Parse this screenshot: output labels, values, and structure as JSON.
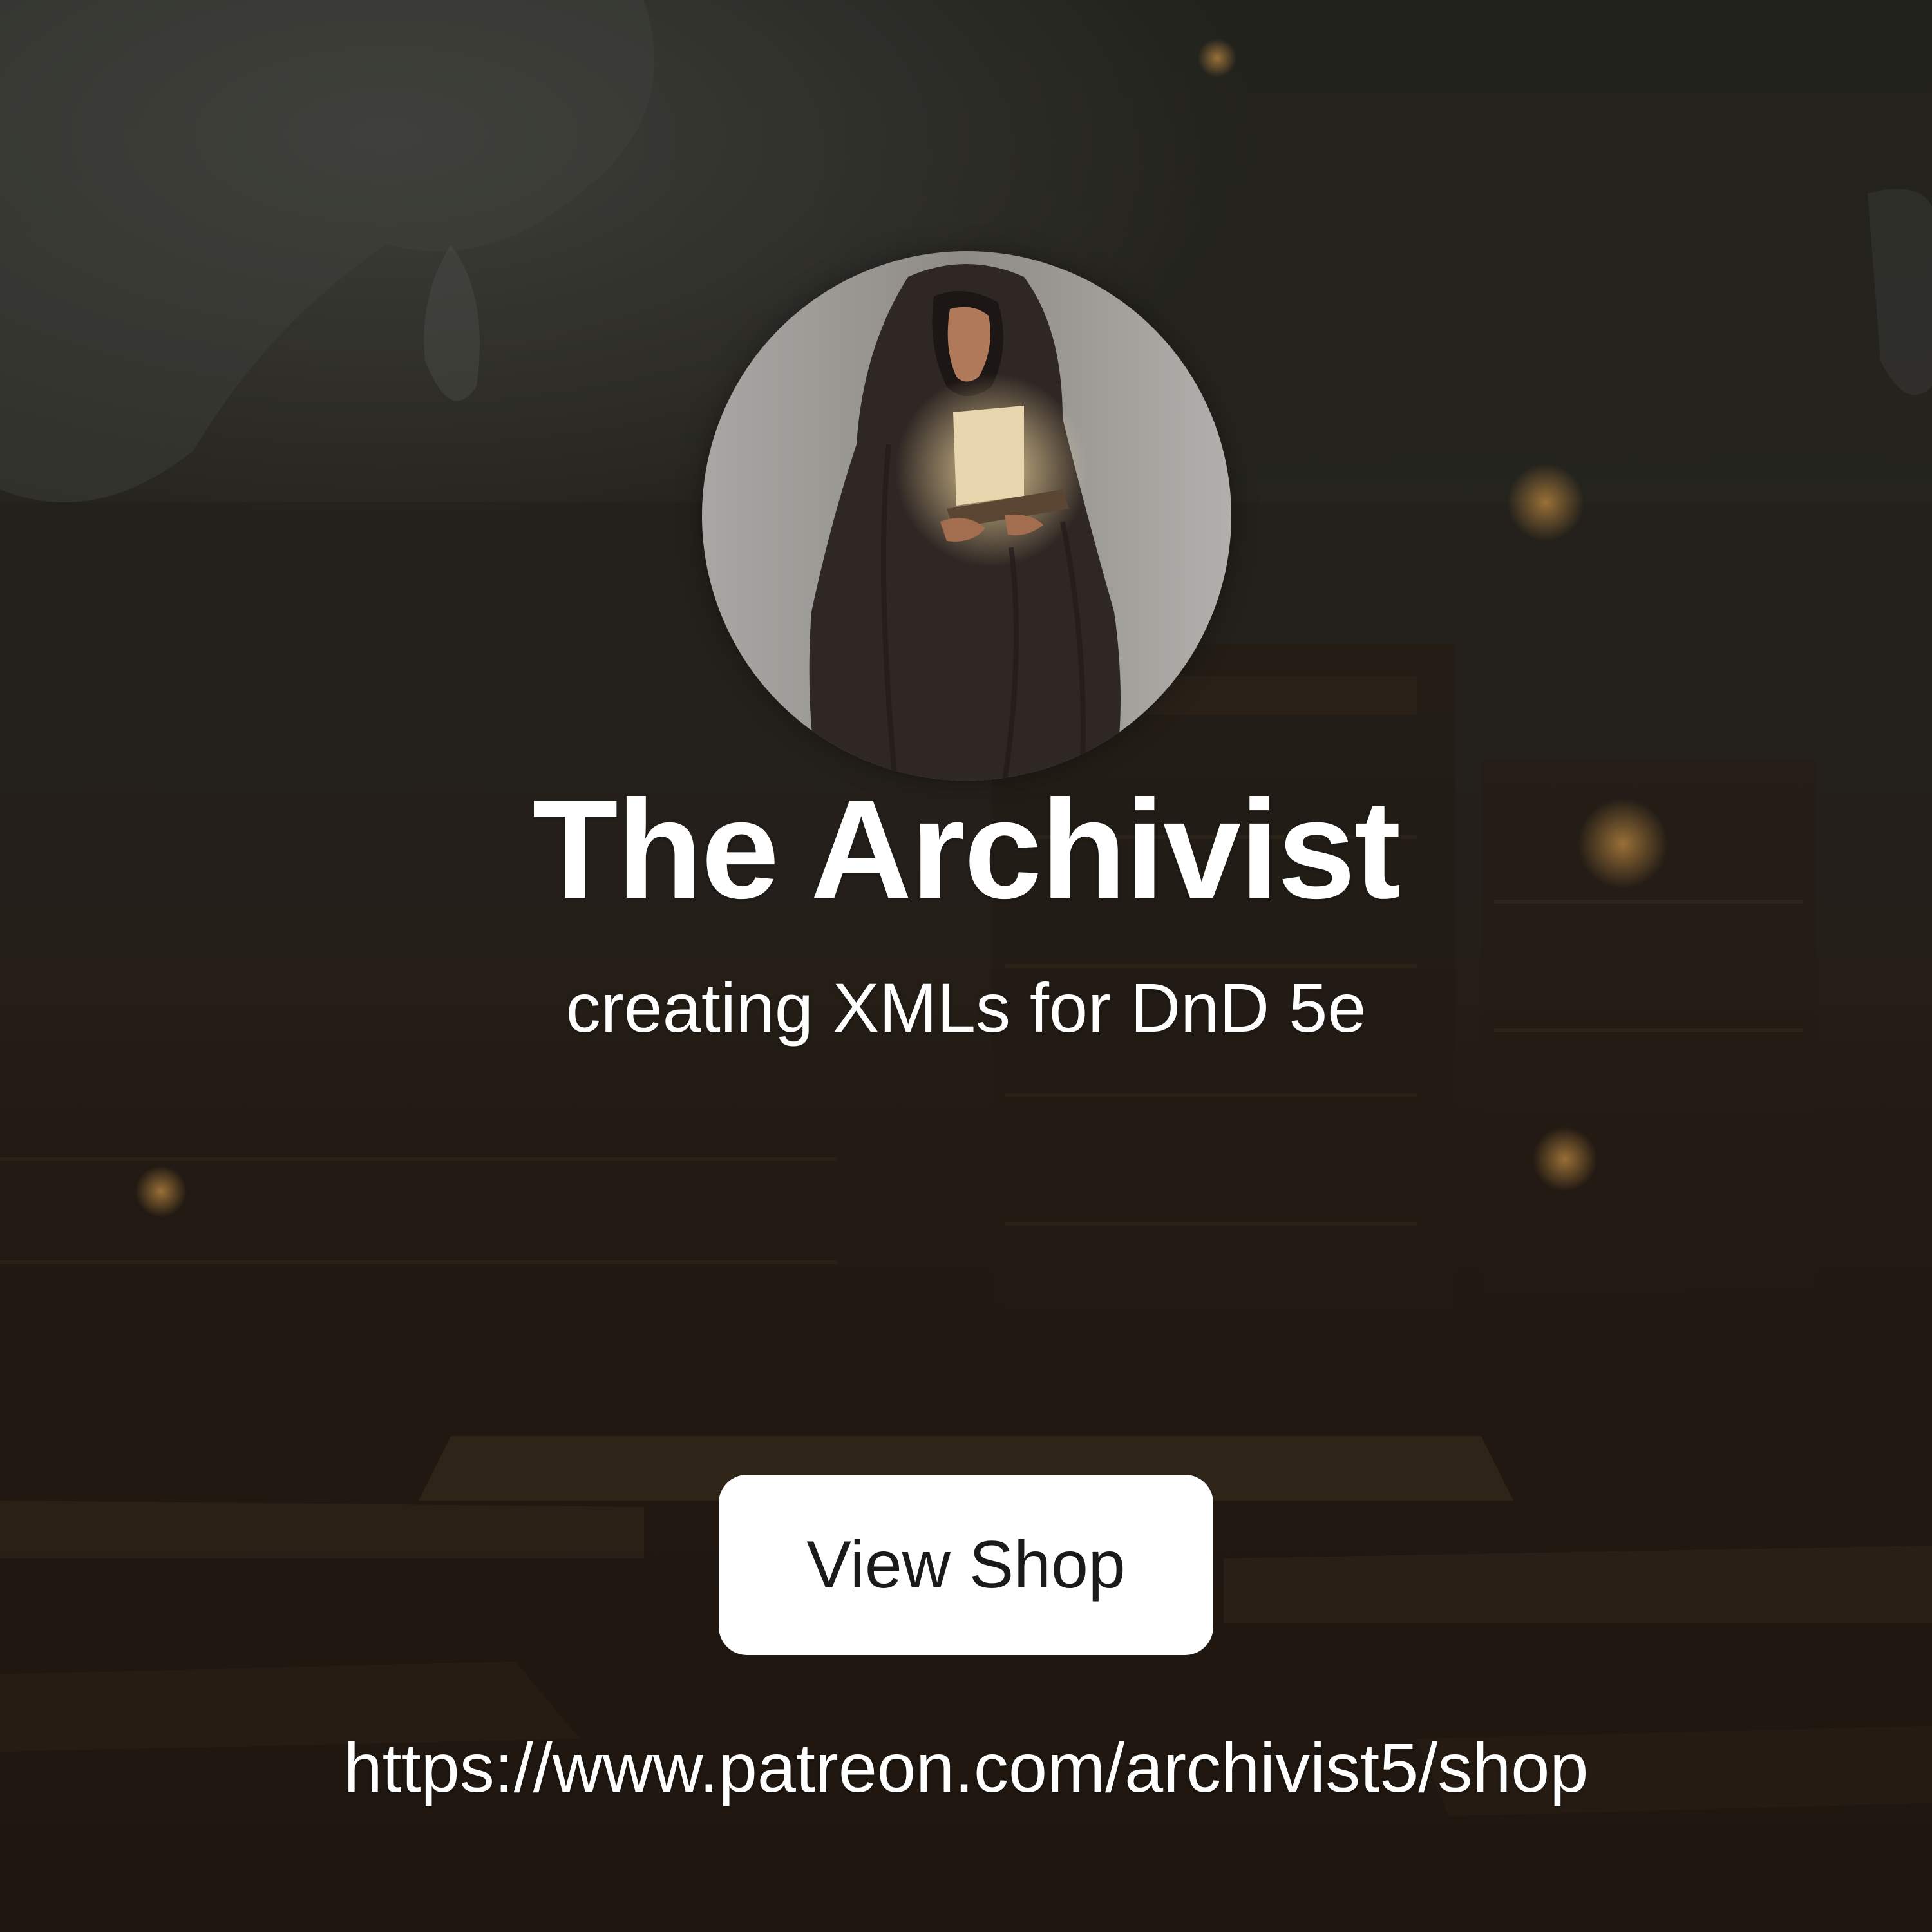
{
  "profile": {
    "name": "The Archivist",
    "tagline": "creating XMLs for DnD 5e",
    "avatar_icon": "hooded-archivist-portrait"
  },
  "actions": {
    "view_shop_label": "View Shop"
  },
  "link": {
    "url_text": "https://www.patreon.com/archivist5/shop"
  },
  "colors": {
    "text": "#ffffff",
    "button_bg": "#ffffff",
    "button_text": "#1a1a1a",
    "background_dark": "#1c1a16"
  }
}
